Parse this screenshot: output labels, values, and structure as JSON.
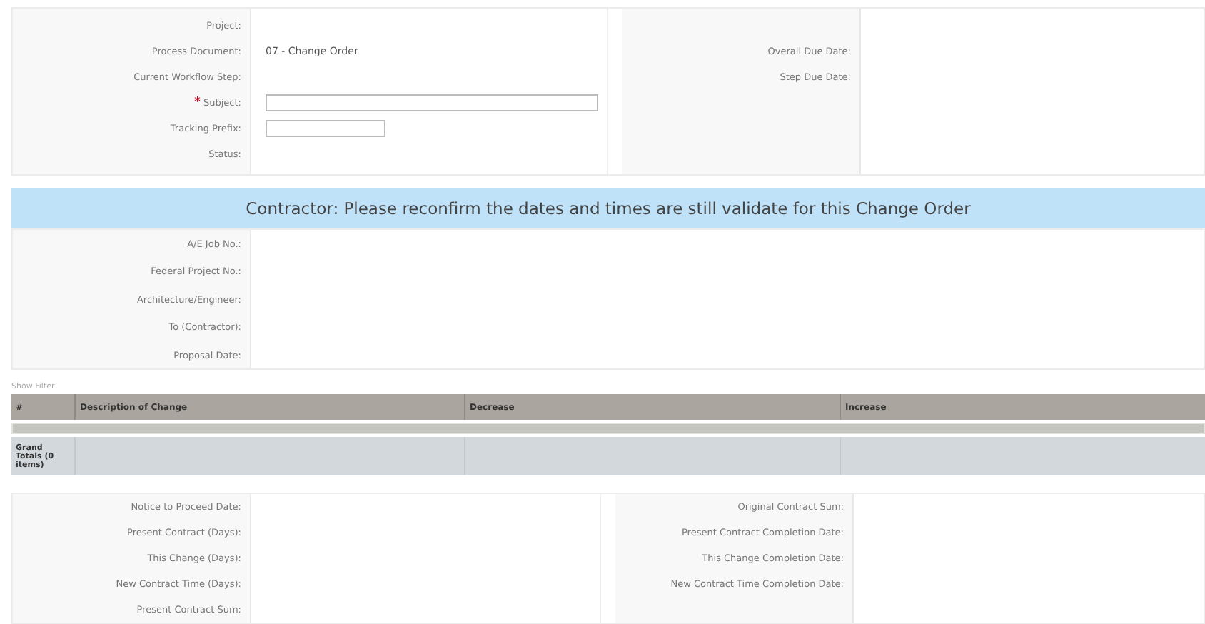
{
  "header_panel": {
    "left": [
      {
        "label": "Project:",
        "kind": "text"
      },
      {
        "label": "Process Document:",
        "kind": "text",
        "value": "07 - Change Order"
      },
      {
        "label": "Current Workflow Step:",
        "kind": "text"
      },
      {
        "label": "Subject:",
        "kind": "wide_input",
        "required": true,
        "required_mark": "*"
      },
      {
        "label": "Tracking Prefix:",
        "kind": "short_input"
      },
      {
        "label": "Status:",
        "kind": "text"
      }
    ],
    "right": [
      {
        "label": "Overall Due Date:"
      },
      {
        "label": "Step Due Date:"
      }
    ]
  },
  "banner": "Contractor: Please reconfirm the dates and times are still validate for this Change Order",
  "details_panel": [
    {
      "label": "A/E Job No.:"
    },
    {
      "label": "Federal Project No.:"
    },
    {
      "label": "Architecture/Engineer:"
    },
    {
      "label": "To (Contractor):"
    },
    {
      "label": "Proposal Date:"
    }
  ],
  "show_filter": "Show Filter",
  "table": {
    "columns": [
      "#",
      "Description of Change",
      "Decrease",
      "Increase"
    ],
    "totals": {
      "label": "Grand Totals (0 items)"
    }
  },
  "contract_panel": {
    "left": [
      {
        "label": "Notice to Proceed Date:"
      },
      {
        "label": "Present Contract (Days):"
      },
      {
        "label": "This Change (Days):"
      },
      {
        "label": "New Contract Time (Days):"
      },
      {
        "label": "Present Contract Sum:"
      }
    ],
    "right": [
      {
        "label": "Original Contract Sum:"
      },
      {
        "label": "Present Contract Completion Date:"
      },
      {
        "label": "This Change Completion Date:"
      },
      {
        "label": "New Contract Time Completion Date:"
      }
    ]
  }
}
